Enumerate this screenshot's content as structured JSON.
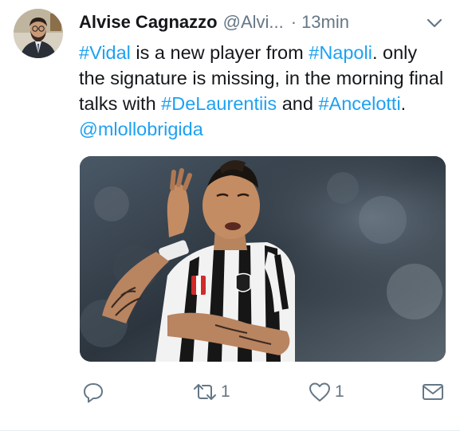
{
  "author": {
    "name": "Alvise Cagnazzo",
    "handle": "@Alvi...",
    "separator": "·",
    "timestamp": "13min"
  },
  "tweet": {
    "segments": [
      {
        "text": "#Vidal",
        "type": "hashtag"
      },
      {
        "text": " is a new player from ",
        "type": "text"
      },
      {
        "text": "#Napoli",
        "type": "hashtag"
      },
      {
        "text": ". only the signature is missing, in the morning final talks with ",
        "type": "text"
      },
      {
        "text": "#DeLaurentiis",
        "type": "hashtag"
      },
      {
        "text": " and ",
        "type": "text"
      },
      {
        "text": "#Ancelotti",
        "type": "hashtag"
      },
      {
        "text": ". ",
        "type": "text"
      },
      {
        "text": "@mlollobrigida",
        "type": "mention"
      }
    ]
  },
  "media": {
    "description_icon": "photo-football-player"
  },
  "actions": {
    "reply": {
      "icon": "reply-icon",
      "count": ""
    },
    "retweet": {
      "icon": "retweet-icon",
      "count": "1"
    },
    "like": {
      "icon": "heart-icon",
      "count": "1"
    },
    "message": {
      "icon": "envelope-icon",
      "count": ""
    }
  },
  "colors": {
    "link": "#1da1f2",
    "secondary_text": "#657786",
    "primary_text": "#14171a"
  }
}
